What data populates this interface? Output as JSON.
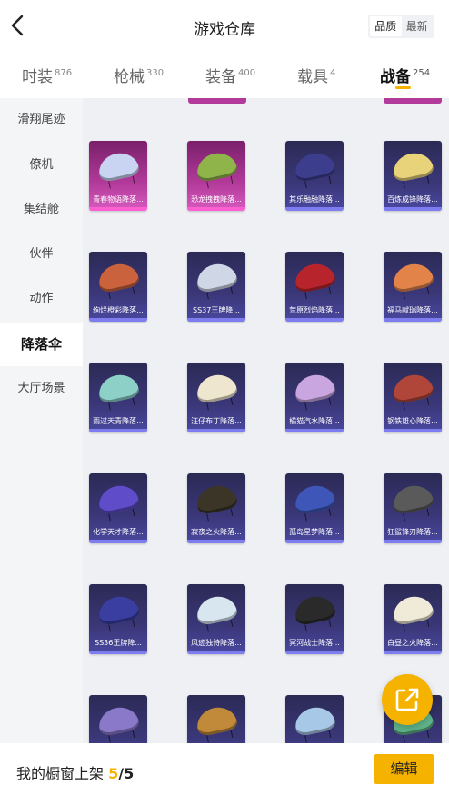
{
  "header": {
    "title": "游戏仓库",
    "back_icon": "chevron-left-icon",
    "sort_options": [
      "品质",
      "最新"
    ],
    "sort_selected": "品质"
  },
  "tabs": [
    {
      "label": "时装",
      "count": "876"
    },
    {
      "label": "枪械",
      "count": "330"
    },
    {
      "label": "装备",
      "count": "400"
    },
    {
      "label": "载具",
      "count": "4"
    },
    {
      "label": "战备",
      "count": "254",
      "active": true
    }
  ],
  "sidebar": {
    "items": [
      "滑翔尾迹",
      "僚机",
      "集结舱",
      "伙伴",
      "动作",
      "降落伞",
      "大厅场景"
    ],
    "active": "降落伞"
  },
  "grid": {
    "items": [
      {
        "label": "青春物语降落...",
        "rarity": "pink",
        "color": "#c9d4f2"
      },
      {
        "label": "恐龙拽拽降落...",
        "rarity": "pink",
        "color": "#8fb44a"
      },
      {
        "label": "其乐融融降落...",
        "rarity": "blue",
        "color": "#3c3d8c"
      },
      {
        "label": "百炼成锋降落...",
        "rarity": "blue",
        "color": "#e8d27a"
      },
      {
        "label": "绚烂橙彩降落...",
        "rarity": "blue",
        "color": "#c9623d"
      },
      {
        "label": "SS37王牌降...",
        "rarity": "blue",
        "color": "#cfd6e6"
      },
      {
        "label": "荒原烈焰降落...",
        "rarity": "blue",
        "color": "#b8242c"
      },
      {
        "label": "福马献瑞降落...",
        "rarity": "blue",
        "color": "#e2834a"
      },
      {
        "label": "雨过天青降落...",
        "rarity": "blue",
        "color": "#8cd0c8"
      },
      {
        "label": "汪仔布丁降落...",
        "rarity": "blue",
        "color": "#efe6cf"
      },
      {
        "label": "橘猫汽水降落...",
        "rarity": "blue",
        "color": "#c9a6e0"
      },
      {
        "label": "钢铁雄心降落...",
        "rarity": "blue",
        "color": "#b0453a"
      },
      {
        "label": "化学天才降落...",
        "rarity": "blue",
        "color": "#5e4cc8"
      },
      {
        "label": "寂夜之火降落...",
        "rarity": "blue",
        "color": "#3a3526"
      },
      {
        "label": "孤岛星梦降落...",
        "rarity": "blue",
        "color": "#3e56b8"
      },
      {
        "label": "狂鲨锋刃降落...",
        "rarity": "blue",
        "color": "#5a5a5a"
      },
      {
        "label": "SS36王牌降...",
        "rarity": "blue",
        "color": "#3a3ea0"
      },
      {
        "label": "风迹独诗降落...",
        "rarity": "blue",
        "color": "#d8e6f0"
      },
      {
        "label": "冥河战士降落...",
        "rarity": "blue",
        "color": "#2a2a2a"
      },
      {
        "label": "白昼之火降落...",
        "rarity": "blue",
        "color": "#f0ead8"
      },
      {
        "label": "",
        "rarity": "blue",
        "color": "#8a78c8"
      },
      {
        "label": "",
        "rarity": "blue",
        "color": "#c08a3a"
      },
      {
        "label": "",
        "rarity": "blue",
        "color": "#a8c8e8"
      },
      {
        "label": "",
        "rarity": "blue",
        "color": "#5fb48a"
      }
    ]
  },
  "share_button": {
    "icon": "share-icon"
  },
  "footer": {
    "label": "我的橱窗上架",
    "current": "5",
    "separator": "/",
    "total": "5",
    "edit_label": "编辑"
  },
  "colors": {
    "accent": "#f5b300",
    "card_blue": "#3a3778",
    "card_pink": "#b23a9a"
  }
}
